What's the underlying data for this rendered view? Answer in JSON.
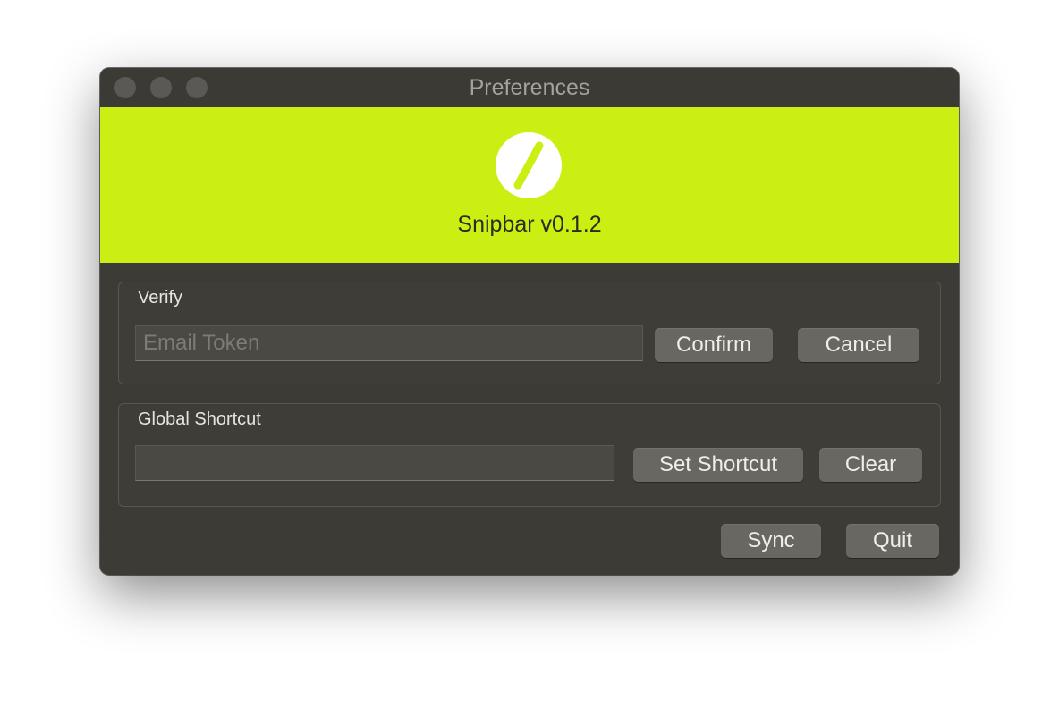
{
  "window": {
    "title": "Preferences"
  },
  "banner": {
    "app_version": "Snipbar v0.1.2",
    "logo_icon": "snipbar-logo-icon",
    "color": "#ccef13"
  },
  "verify": {
    "label": "Verify",
    "token_placeholder": "Email Token",
    "token_value": "",
    "confirm_label": "Confirm",
    "cancel_label": "Cancel"
  },
  "shortcut": {
    "label": "Global Shortcut",
    "shortcut_value": "",
    "set_label": "Set Shortcut",
    "clear_label": "Clear"
  },
  "footer": {
    "sync_label": "Sync",
    "quit_label": "Quit"
  }
}
